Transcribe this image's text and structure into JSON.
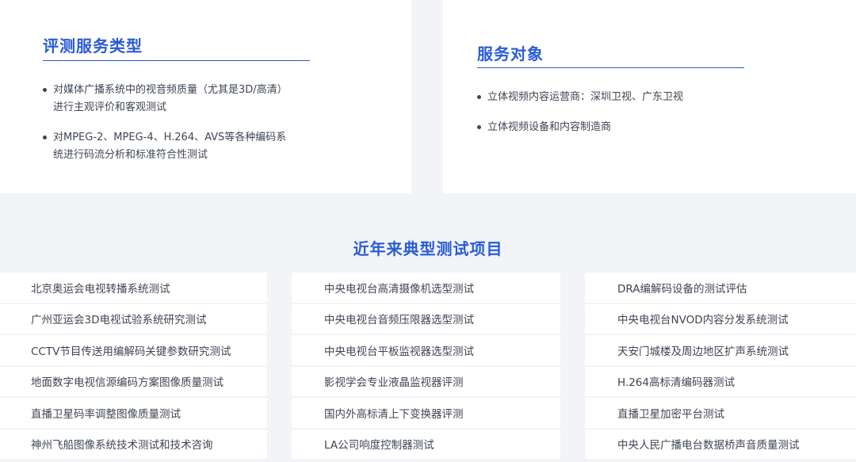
{
  "service_types": {
    "title": "评测服务类型",
    "items": [
      {
        "line1": "对媒体广播系统中的视音频质量（尤其是3D/高清）",
        "line2": "进行主观评价和客观测试"
      },
      {
        "line1": "对MPEG-2、MPEG-4、H.264、AVS等各种编码系",
        "line2": "统进行码流分析和标准符合性测试"
      }
    ]
  },
  "service_targets": {
    "title": "服务对象",
    "items": [
      "立体视频内容运营商：深圳卫视、广东卫视",
      "立体视频设备和内容制造商"
    ]
  },
  "projects": {
    "title": "近年来典型测试项目",
    "columns": [
      [
        "北京奥运会电视转播系统测试",
        "广州亚运会3D电视试验系统研究测试",
        "CCTV节目传送用编解码关键参数研究测试",
        "地面数字电视信源编码方案图像质量测试",
        "直播卫星码率调整图像质量测试",
        "神州飞船图像系统技术测试和技术咨询"
      ],
      [
        "中央电视台高清摄像机选型测试",
        "中央电视台音频压限器选型测试",
        "中央电视台平板监视器选型测试",
        "影视学会专业液晶监视器评测",
        "国内外高标清上下变换器评测",
        "LA公司响度控制器测试"
      ],
      [
        "DRA编解码设备的测试评估",
        "中央电视台NVOD内容分发系统测试",
        "天安门城楼及周边地区扩声系统测试",
        "H.264高标清编码器测试",
        "直播卫星加密平台测试",
        "中央人民广播电台数据桥声音质量测试"
      ]
    ]
  },
  "colors": {
    "accent": "#2a5bd7",
    "background": "#f2f4f8",
    "card": "#ffffff",
    "text": "#3e4553"
  }
}
